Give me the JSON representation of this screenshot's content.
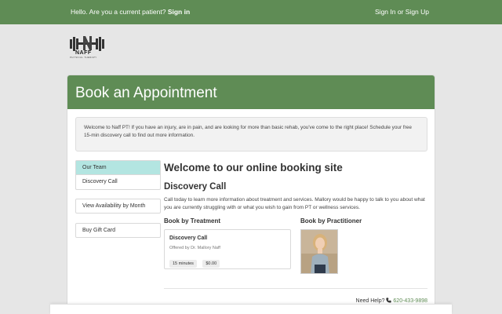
{
  "topbar": {
    "greeting": "Hello. Are you a current patient?",
    "sign_in": "Sign in",
    "sign_in_up": "Sign In or Sign Up"
  },
  "logo": {
    "name": "NAFF",
    "tagline": "PHYSICAL THERAPY"
  },
  "page": {
    "title": "Book an Appointment"
  },
  "notice": {
    "text": "Welcome to Naff PT! If you have an injury, are in pain, and are looking for more than basic rehab, you've come to the right place! Schedule your free 15-min discovery call to find out more information."
  },
  "sidebar": {
    "items": [
      {
        "label": "Our Team"
      },
      {
        "label": "Discovery Call"
      }
    ],
    "availability": "View Availability by Month",
    "gift_card": "Buy Gift Card"
  },
  "main": {
    "heading": "Welcome to our online booking site",
    "subheading": "Discovery Call",
    "description": "Call today to learn more information about treatment and services. Mallory would be happy to talk to you about what you are currently struggling with or what you wish to gain from PT or wellness services.",
    "by_treatment": "Book by Treatment",
    "by_practitioner": "Book by Practitioner",
    "service": {
      "name": "Discovery Call",
      "offered_by": "Offered by Dr. Mallory Naff",
      "duration": "15 minutes",
      "price": "$0.00"
    }
  },
  "footer": {
    "need_help": "Need Help?",
    "phone": "620-433-9898"
  },
  "colors": {
    "brand_green": "#5f8c55",
    "active_tab": "#b3e5e1"
  }
}
